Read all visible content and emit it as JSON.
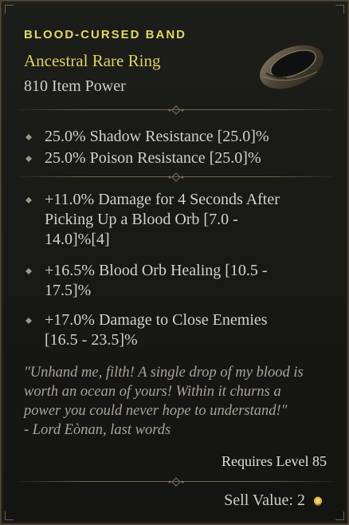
{
  "item": {
    "name": "BLOOD-CURSED BAND",
    "rarity_type": "Ancestral Rare Ring",
    "item_power": "810 Item Power"
  },
  "implicit_affixes": [
    "25.0% Shadow Resistance [25.0]%",
    "25.0% Poison Resistance [25.0]%"
  ],
  "affixes": [
    [
      "+11.0% Damage for 4 Seconds After",
      "Picking Up a Blood Orb [7.0 -",
      "14.0]%[4]"
    ],
    [
      "+16.5% Blood Orb Healing [10.5 -",
      "17.5]%"
    ],
    [
      "+17.0% Damage to Close Enemies",
      "[16.5 - 23.5]%"
    ]
  ],
  "flavor": [
    "\"Unhand me, filth! A single drop of my blood is",
    "worth an ocean of yours! Within it churns a",
    "power you could never hope to understand!\"",
    "- Lord Eònan, last words"
  ],
  "requirement": "Requires Level 85",
  "sell_value": "Sell Value: 2",
  "colors": {
    "name": "#e2d95a",
    "rarity": "#dcd35a",
    "body_text": "#d2d2cb",
    "flavor": "#a9a49a",
    "border": "#4a4437"
  },
  "icons": {
    "item_image": "ring-icon",
    "bullet": "diamond-bullet-icon",
    "currency": "gold-coin-icon"
  }
}
